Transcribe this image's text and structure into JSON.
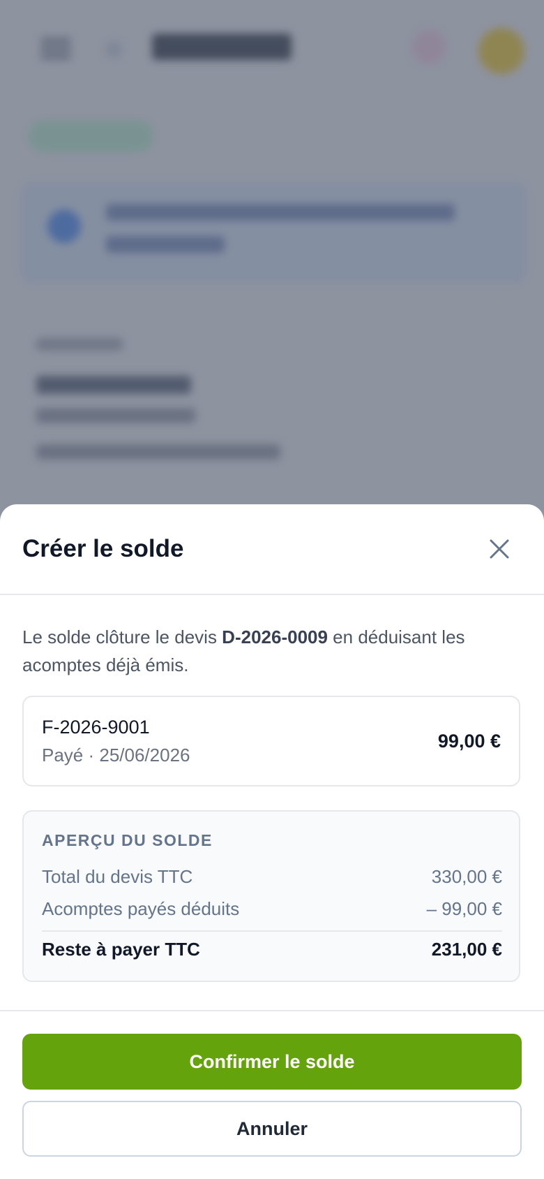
{
  "sheet": {
    "title": "Créer le solde",
    "close_icon": "close-icon",
    "description": {
      "before": "Le solde clôture le devis ",
      "quote_number": "D-2026-0009",
      "after": " en déduisant les acomptes déjà émis."
    },
    "invoice": {
      "number": "F-2026-9001",
      "status": "Payé · 25/06/2026",
      "amount": "99,00 €"
    },
    "summary": {
      "heading": "APERÇU DU SOLDE",
      "rows": [
        {
          "label": "Total du devis TTC",
          "value": "330,00 €"
        },
        {
          "label": "Acomptes payés déduits",
          "value": "– 99,00 €"
        }
      ],
      "total": {
        "label": "Reste à payer TTC",
        "value": "231,00 €"
      }
    },
    "buttons": {
      "confirm": "Confirmer le solde",
      "cancel": "Annuler"
    }
  },
  "colors": {
    "accent": "#65a30d",
    "text": "#111827",
    "muted": "#6b7280",
    "overlay": "#586072"
  }
}
